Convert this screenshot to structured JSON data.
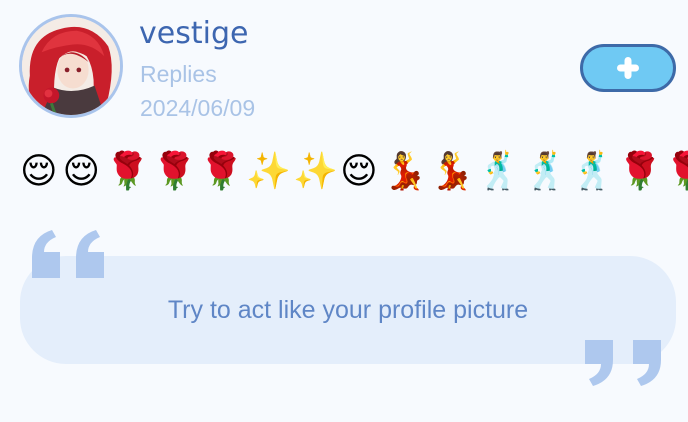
{
  "profile": {
    "username": "vestige",
    "subtitle": "Replies",
    "date": "2024/06/09",
    "avatar_icon": "avatar-red-haired-character"
  },
  "actions": {
    "add_icon": "plus-icon",
    "accent_color": "#6fc9f3"
  },
  "emojis": [
    "😌",
    "😌",
    "🌹",
    "🌹",
    "🌹",
    "✨",
    "✨",
    "😌",
    "💃",
    "💃",
    "🕺",
    "🕺",
    "🕺",
    "🌹",
    "🌹"
  ],
  "quote": {
    "text": "Try to act like your profile picture",
    "open_icon": "quote-open-icon",
    "close_icon": "quote-close-icon"
  }
}
